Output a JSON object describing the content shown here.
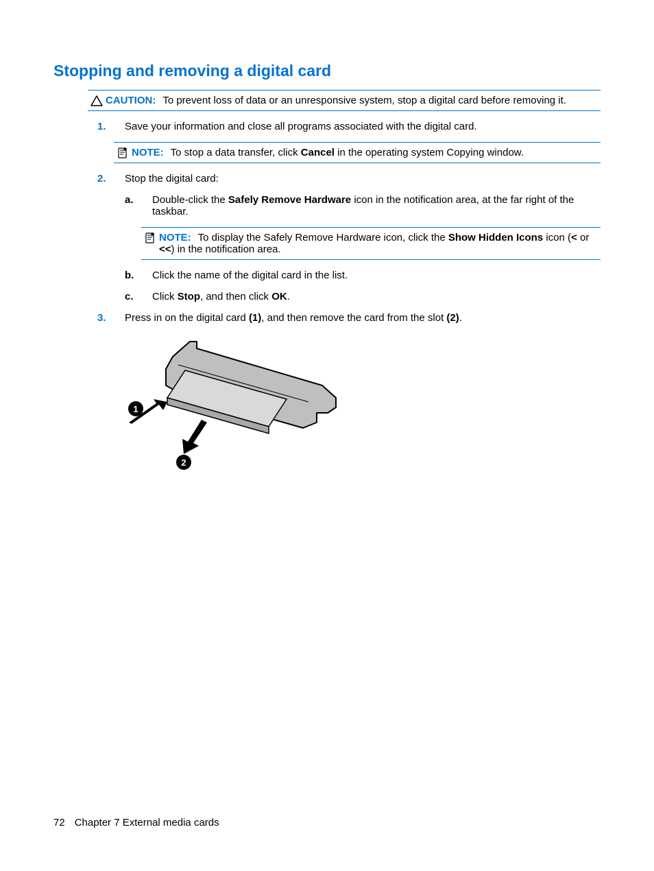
{
  "title": "Stopping and removing a digital card",
  "caution": {
    "label": "CAUTION:",
    "text": "To prevent loss of data or an unresponsive system, stop a digital card before removing it."
  },
  "steps": {
    "s1": {
      "num": "1.",
      "text": "Save your information and close all programs associated with the digital card."
    },
    "note1": {
      "label": "NOTE:",
      "pre": "To stop a data transfer, click ",
      "bold1": "Cancel",
      "post": " in the operating system Copying window."
    },
    "s2": {
      "num": "2.",
      "text": "Stop the digital card:"
    },
    "s2a": {
      "letter": "a.",
      "pre": "Double-click the ",
      "bold1": "Safely Remove Hardware",
      "post": " icon in the notification area, at the far right of the taskbar."
    },
    "note2": {
      "label": "NOTE:",
      "pre": "To display the Safely Remove Hardware icon, click the ",
      "bold1": "Show Hidden Icons",
      "mid": " icon (",
      "bold2": "<",
      "or": " or ",
      "bold3": "<<",
      "post": ") in the notification area."
    },
    "s2b": {
      "letter": "b.",
      "text": "Click the name of the digital card in the list."
    },
    "s2c": {
      "letter": "c.",
      "pre": "Click ",
      "bold1": "Stop",
      "mid": ", and then click ",
      "bold2": "OK",
      "post": "."
    },
    "s3": {
      "num": "3.",
      "pre": "Press in on the digital card ",
      "bold1": "(1)",
      "mid": ", and then remove the card from the slot ",
      "bold2": "(2)",
      "post": "."
    }
  },
  "footer": {
    "page": "72",
    "chapter": "Chapter 7   External media cards"
  }
}
